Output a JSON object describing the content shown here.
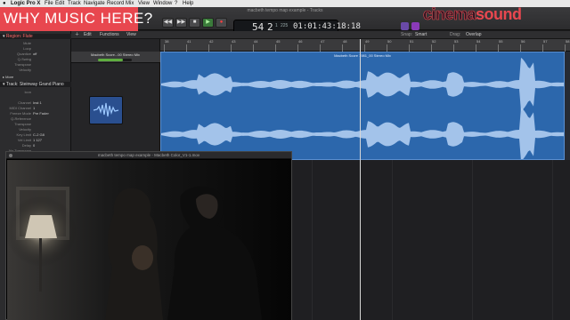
{
  "banner": {
    "text": "WHY MUSIC HERE?"
  },
  "logo": {
    "part_a": "cinema",
    "part_b": "sound"
  },
  "menubar": {
    "app": "Logic Pro X",
    "items": [
      "File",
      "Edit",
      "Track",
      "Navigate",
      "Record",
      "Mix",
      "View",
      "Window",
      "?",
      "Help"
    ]
  },
  "window": {
    "title": "macbeth tempo map example - Tracks"
  },
  "transport": {
    "bar": "54",
    "beat": "2",
    "div": "1",
    "tick": "225",
    "time": "01:01:43:18:18",
    "icons": [
      "rewind-icon",
      "fast-forward-icon",
      "stop-icon",
      "play-icon",
      "record-icon"
    ]
  },
  "inspector": {
    "region_header": "Region: Flute",
    "rows": [
      {
        "k": "Mute",
        "v": ""
      },
      {
        "k": "Loop",
        "v": ""
      },
      {
        "k": "Quantize",
        "v": "off"
      },
      {
        "k": "Q-Swing",
        "v": ""
      },
      {
        "k": "Transpose",
        "v": ""
      },
      {
        "k": "Velocity",
        "v": ""
      }
    ],
    "more_label": "More",
    "track_header": "Track: Steinway Grand Piano",
    "track_rows": [
      {
        "k": "Icon",
        "v": ""
      },
      {
        "k": "Channel",
        "v": "Inst 1"
      },
      {
        "k": "MIDI Channel",
        "v": "1"
      },
      {
        "k": "Freeze Mode",
        "v": "Pre Fader"
      },
      {
        "k": "Q-Reference",
        "v": ""
      },
      {
        "k": "Transpose",
        "v": ""
      },
      {
        "k": "Velocity",
        "v": ""
      },
      {
        "k": "Key Limit",
        "v": "C-2  G8"
      },
      {
        "k": "Vel Limit",
        "v": "1  127"
      },
      {
        "k": "Delay",
        "v": "0"
      },
      {
        "k": "No Transpose",
        "v": ""
      }
    ]
  },
  "local_menu": {
    "items": [
      "Edit",
      "Functions",
      "View"
    ],
    "snap_label": "Snap:",
    "snap_value": "Smart",
    "drag_label": "Drag:",
    "drag_value": "Overlap"
  },
  "ruler": {
    "ticks": [
      "38",
      "41",
      "42",
      "43",
      "44",
      "45",
      "46",
      "47",
      "48",
      "49",
      "50",
      "51",
      "52",
      "53",
      "54",
      "55",
      "56",
      "57",
      "58"
    ]
  },
  "track": {
    "name": "Macbeth Score...00 Stereo Mix"
  },
  "region": {
    "title": "Macbeth Score 1981_00 Stereo Mix"
  },
  "movie": {
    "title": "macbeth tempo map example - Macbeth Color_V1-1.mov"
  }
}
